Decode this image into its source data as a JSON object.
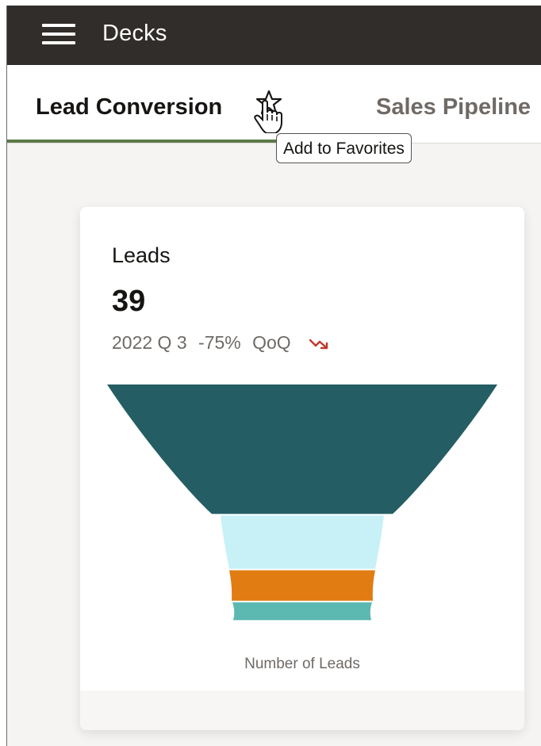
{
  "header": {
    "menu_icon": "hamburger-icon",
    "title": "Decks"
  },
  "tabs": [
    {
      "label": "Lead Conversion",
      "selected": true
    },
    {
      "label": "Sales Pipeline",
      "selected": false
    }
  ],
  "favorite": {
    "icon": "star-icon",
    "tooltip": "Add to Favorites"
  },
  "card": {
    "title": "Leads",
    "value": "39",
    "period": "2022 Q 3",
    "change": "-75%",
    "comparison": "QoQ",
    "trend_icon": "trend-down-icon",
    "trend_color": "#c0392b"
  },
  "chart_data": {
    "type": "funnel",
    "xlabel": "Number of Leads",
    "stages": [
      {
        "fraction": 0.51,
        "color": "#245e64"
      },
      {
        "fraction": 0.21,
        "color": "#c7f1f6"
      },
      {
        "fraction": 0.12,
        "color": "#e07c11"
      },
      {
        "fraction": 0.07,
        "color": "#5cb9b2"
      }
    ]
  },
  "colors": {
    "header_bg": "#312d2a",
    "tab_underline": "#5b7a49"
  }
}
